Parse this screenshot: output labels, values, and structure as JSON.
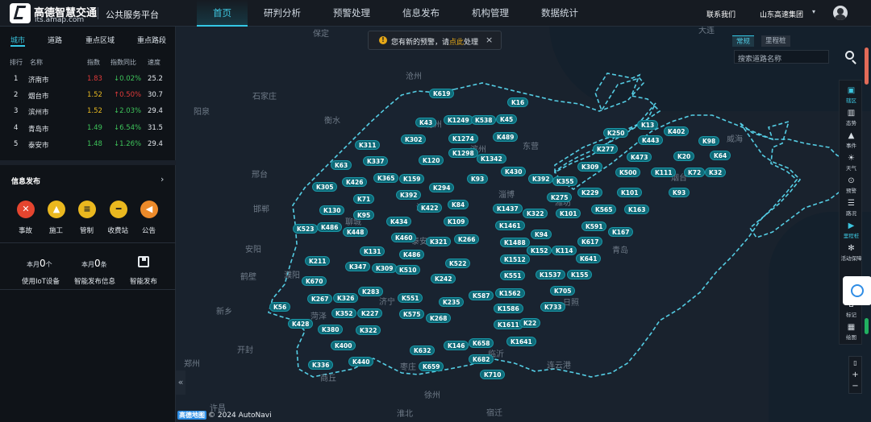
{
  "header": {
    "brand_cn": "高德智慧交通",
    "brand_url": "its.amap.com",
    "platform": "公共服务平台",
    "nav": [
      "首页",
      "研判分析",
      "预警处理",
      "信息发布",
      "机构管理",
      "数据统计"
    ],
    "contact": "联系我们",
    "group": "山东高速集团"
  },
  "toast": {
    "text_before": "您有新的预警，请",
    "link": "点此",
    "text_after": "处理",
    "close": "×"
  },
  "search": {
    "tab_active": "常规",
    "tab_other": "里程桩",
    "placeholder": "搜索道路名称"
  },
  "rail": [
    "辖区",
    "态势",
    "事件",
    "天气",
    "预警",
    "路况",
    "里程桩",
    "活动保障",
    "标记",
    "绘图"
  ],
  "map": {
    "attribution": "© 2024 AutoNavi",
    "brand": "高德地图",
    "collapse": "«",
    "cities": [
      "保定",
      "沧州",
      "石家庄",
      "衡水",
      "阳泉",
      "德州",
      "邢台",
      "邯郸",
      "聊城",
      "滨州",
      "东营",
      "淄博",
      "潍坊",
      "济南",
      "泰安",
      "菏泽",
      "济宁",
      "枣庄",
      "临沂",
      "日照",
      "青岛",
      "烟台",
      "威海",
      "濮阳",
      "安阳",
      "鹤壁",
      "新乡",
      "开封",
      "郑州",
      "商丘",
      "许昌",
      "徐州",
      "宿迁",
      "淮北",
      "连云港",
      "大连"
    ],
    "markers": [
      "K619",
      "K16",
      "K43",
      "K1249",
      "K538",
      "K45",
      "K302",
      "K1274",
      "K489",
      "K311",
      "K1298",
      "K120",
      "K1342",
      "K337",
      "K63",
      "K365",
      "K159",
      "K93",
      "K430",
      "K392",
      "K355",
      "K309",
      "K426",
      "K294",
      "K392",
      "K305",
      "K71",
      "K84",
      "K275",
      "K229",
      "K101",
      "K130",
      "K95",
      "K422",
      "K1437",
      "K322",
      "K101",
      "K565",
      "K163",
      "K486",
      "K448",
      "K434",
      "K109",
      "K1461",
      "K591",
      "K523",
      "K460",
      "K321",
      "K266",
      "K94",
      "K617",
      "K167",
      "K131",
      "K486",
      "K1488",
      "K152",
      "K114",
      "K641",
      "K211",
      "K347",
      "K309",
      "K510",
      "K522",
      "K1512",
      "K242",
      "K551",
      "K1537",
      "K155",
      "K670",
      "K283",
      "K267",
      "K326",
      "K551",
      "K235",
      "K587",
      "K1562",
      "K705",
      "K56",
      "K352",
      "K227",
      "K575",
      "K268",
      "K1586",
      "K733",
      "K428",
      "K380",
      "K322",
      "K1611",
      "K22",
      "K400",
      "K632",
      "K146",
      "K658",
      "K1641",
      "K336",
      "K440",
      "K659",
      "K682",
      "K710",
      "K250",
      "K13",
      "K402",
      "K277",
      "K443",
      "K98",
      "K473",
      "K20",
      "K64",
      "K500",
      "K111",
      "K72",
      "K32",
      "K93"
    ]
  },
  "left": {
    "tabs": [
      "城市",
      "道路",
      "重点区域",
      "重点路段"
    ],
    "columns": [
      "排行",
      "名称",
      "指数",
      "指数同比",
      "速度"
    ],
    "rows": [
      {
        "rank": "1",
        "name": "济南市",
        "index": "1.83",
        "change": "↓0.02%",
        "speed": "25.2"
      },
      {
        "rank": "2",
        "name": "烟台市",
        "index": "1.52",
        "change": "↑0.50%",
        "speed": "30.7"
      },
      {
        "rank": "3",
        "name": "滨州市",
        "index": "1.52",
        "change": "↓2.03%",
        "speed": "29.4"
      },
      {
        "rank": "4",
        "name": "青岛市",
        "index": "1.49",
        "change": "↓6.54%",
        "speed": "31.5"
      },
      {
        "rank": "5",
        "name": "泰安市",
        "index": "1.48",
        "change": "↓1.26%",
        "speed": "29.4"
      }
    ],
    "index_colors": [
      "#e03a3a",
      "#e6b820",
      "#e6b820",
      "#3ec45a",
      "#3ec45a"
    ],
    "change_colors": [
      "#3ec45a",
      "#e03a3a",
      "#3ec45a",
      "#3ec45a",
      "#3ec45a"
    ],
    "info_title": "信息发布",
    "info_arrow": "›",
    "quick": [
      {
        "label": "事故",
        "icon": "accident-icon",
        "color": "#e5452f"
      },
      {
        "label": "施工",
        "icon": "construction-icon",
        "color": "#eab81f"
      },
      {
        "label": "管制",
        "icon": "control-icon",
        "color": "#eab81f"
      },
      {
        "label": "收费站",
        "icon": "tollgate-icon",
        "color": "#eab81f"
      },
      {
        "label": "公告",
        "icon": "announcement-icon",
        "color": "#ec8a2a"
      }
    ],
    "stats": [
      {
        "prefix": "本月",
        "value": "0",
        "unit": "个",
        "label": "使用IoT设备"
      },
      {
        "prefix": "本月",
        "value": "0",
        "unit": "条",
        "label": "智能发布信息"
      }
    ],
    "publish_label": "智能发布"
  }
}
